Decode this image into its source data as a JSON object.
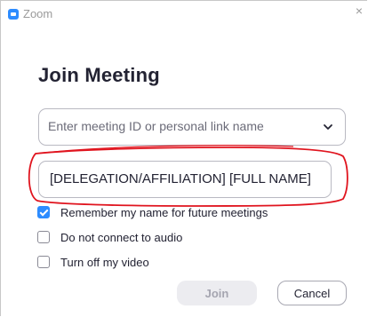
{
  "window": {
    "title": "Zoom",
    "close_glyph": "×"
  },
  "dialog": {
    "heading": "Join Meeting",
    "meeting_id_placeholder": "Enter meeting ID or personal link name",
    "name_value": "[DELEGATION/AFFILIATION] [FULL NAME]",
    "options": [
      {
        "label": "Remember my name for future meetings",
        "checked": true
      },
      {
        "label": "Do not connect to audio",
        "checked": false
      },
      {
        "label": "Turn off my video",
        "checked": false
      }
    ],
    "join_label": "Join",
    "cancel_label": "Cancel"
  },
  "colors": {
    "accent": "#2d8cff",
    "annotation": "#e0141e",
    "text": "#232333",
    "disabled_button": "#ececf0"
  },
  "icons": {
    "app": "zoom-camera-icon",
    "close": "close-icon",
    "dropdown": "chevron-down-icon"
  }
}
